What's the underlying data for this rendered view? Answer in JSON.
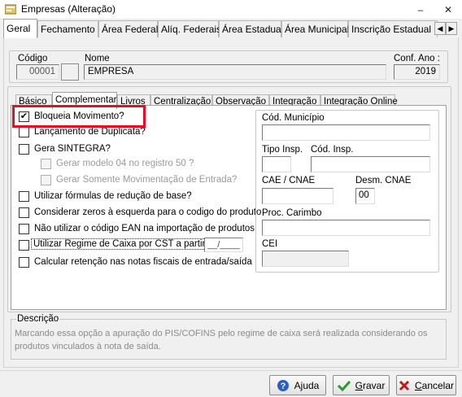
{
  "window": {
    "title": "Empresas (Alteração)",
    "min_glyph": "–",
    "max_glyph": "☐",
    "close_glyph": "✕"
  },
  "main_tabs": [
    "Geral",
    "Fechamento",
    "Área Federal",
    "Alíq. Federais",
    "Área Estadual",
    "Área Municipal",
    "Inscrição Estadual S"
  ],
  "tab_scroll": {
    "left": "◀",
    "right": "▶"
  },
  "header": {
    "codigo_label": "Código",
    "codigo_value": "00001",
    "nome_label": "Nome",
    "nome_value": "EMPRESA",
    "conf_ano_label": "Conf. Ano :",
    "conf_ano_value": "2019"
  },
  "inner_tabs": [
    "Básico",
    "Complementar",
    "Livros",
    "Centralização",
    "Observação",
    "Integração",
    "Integração Online"
  ],
  "checkboxes": {
    "bloqueia": {
      "label": "Bloqueia Movimento?",
      "mark": "✔"
    },
    "lancamento": {
      "label": "Lançamento de Duplicata?"
    },
    "sintegra": {
      "label": "Gera SINTEGRA?"
    },
    "modelo04": {
      "label": "Gerar modelo 04 no registro 50 ?"
    },
    "somente_mov": {
      "label": "Gerar Somente Movimentação de Entrada?"
    },
    "formulas": {
      "label": "Utilizar fórmulas de redução de base?"
    },
    "zeros": {
      "label": "Considerar zeros à esquerda para o codigo do produto"
    },
    "ean": {
      "label": "Não utilizar o código EAN na importação de produtos"
    },
    "regime_caixa": {
      "label": "Utilizar Regime de Caixa por CST a partir de",
      "date_value": "__/____"
    },
    "retencao": {
      "label": "Calcular retenção nas notas fiscais de entrada/saída"
    }
  },
  "right_fields": {
    "cod_municipio_label": "Cód. Município",
    "tipo_insp_label": "Tipo Insp.",
    "cod_insp_label": "Cód. Insp.",
    "cae_label": "CAE / CNAE",
    "desm_label": "Desm. CNAE",
    "desm_value": "00",
    "proc_label": "Proc. Carimbo",
    "cei_label": "CEI"
  },
  "description": {
    "label": "Descrição",
    "text": "Marcando essa opção a apuração do PIS/COFINS pelo regime de caixa será realizada considerando os produtos vinculados à nota de saída."
  },
  "buttons": {
    "ajuda_pre": "A",
    "ajuda_u": "j",
    "ajuda_post": "uda",
    "gravar_pre": "",
    "gravar_u": "G",
    "gravar_post": "ravar",
    "cancelar_pre": "",
    "cancelar_u": "C",
    "cancelar_post": "ancelar"
  },
  "colors": {
    "highlight": "#e0102a",
    "help_blue": "#2a5fc0",
    "ok_green": "#2a9a2a",
    "cancel_red": "#c01818"
  }
}
